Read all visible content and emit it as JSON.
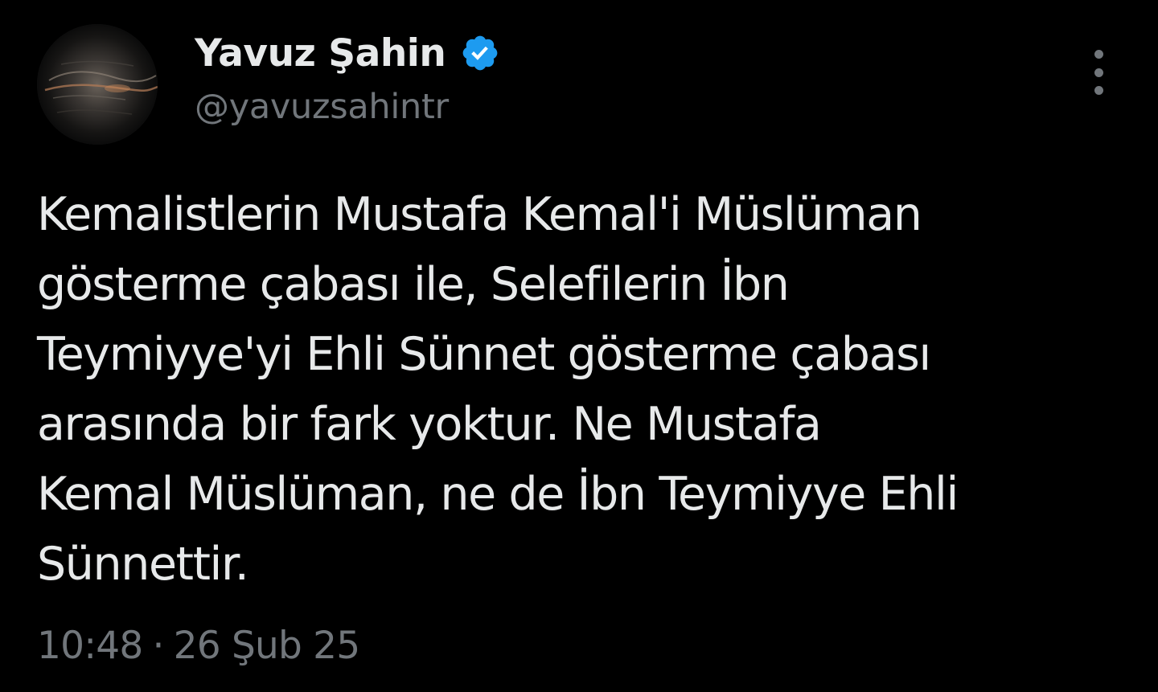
{
  "author": {
    "display_name": "Yavuz Şahin",
    "handle": "@yavuzsahintr",
    "verified": true,
    "avatar_icon": "profile-photo-avatar",
    "badge_icon": "verified-badge-icon"
  },
  "menu": {
    "icon": "more-options-icon"
  },
  "tweet": {
    "text_lines": [
      "Kemalistlerin Mustafa Kemal'i Müslüman",
      "gösterme çabası ile, Selefilerin İbn",
      "Teymiyye'yi Ehli Sünnet gösterme çabası",
      "arasında bir fark yoktur. Ne Mustafa",
      "Kemal Müslüman, ne de İbn Teymiyye Ehli",
      "Sünnettir."
    ]
  },
  "meta": {
    "time": "10:48",
    "separator": "·",
    "date": "26 Şub 25"
  },
  "colors": {
    "background": "#000000",
    "primary_text": "#e7e9ea",
    "secondary_text": "#71767b",
    "verified_blue": "#1d9bf0"
  }
}
